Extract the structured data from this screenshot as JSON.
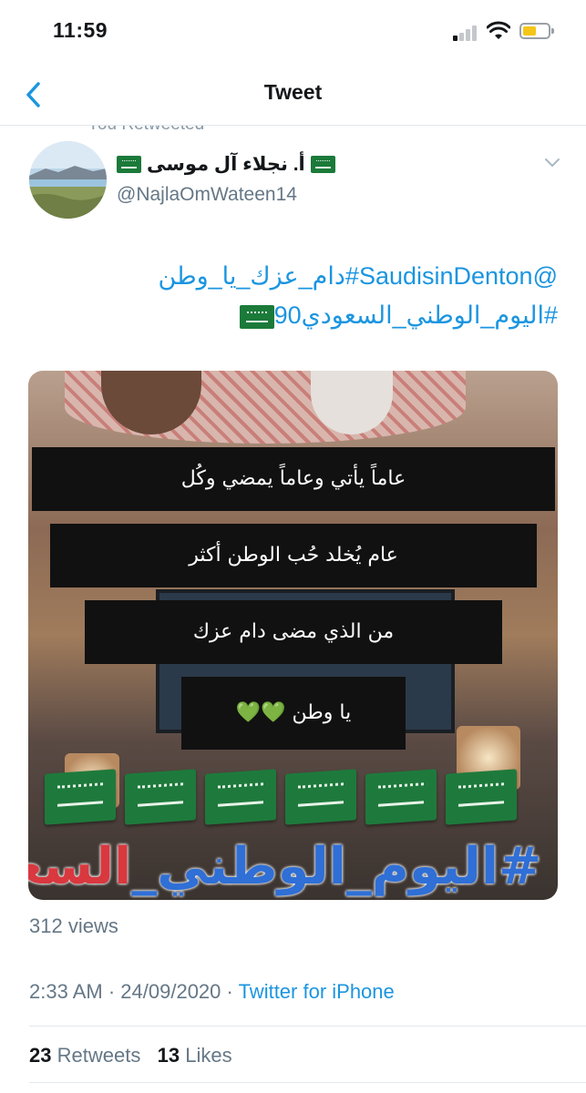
{
  "status_bar": {
    "time": "11:59"
  },
  "nav": {
    "title": "Tweet"
  },
  "retweet_context": {
    "label": "You Retweeted"
  },
  "author": {
    "display_name": "أ. نجلاء آل موسى",
    "handle": "@NajlaOmWateen14"
  },
  "tweet": {
    "line1": "@SaudisinDenton#دام_عزك_يا_وطن",
    "line2": "#اليوم_الوطني_السعودي90"
  },
  "video": {
    "caption1": "عاماً يأتي وعاماً يمضي وكُل",
    "caption2": "عام يُخلد حُب الوطن أكثر",
    "caption3": "من الذي مضى دام عزك",
    "caption4": "يا وطن",
    "hearts": "💚💚",
    "hashtag_blue": "#اليوم_الوطني_",
    "hashtag_red": "السعودي"
  },
  "views": "312 views",
  "meta": {
    "time": "2:33 AM",
    "date": "24/09/2020",
    "separator": "·",
    "source": "Twitter for iPhone"
  },
  "stats": {
    "retweets_count": "23",
    "retweets_label": "Retweets",
    "likes_count": "13",
    "likes_label": "Likes"
  },
  "colors": {
    "link": "#1b95e0",
    "muted": "#657786",
    "flag_green": "#1e7a3c",
    "battery": "#f5c518"
  }
}
